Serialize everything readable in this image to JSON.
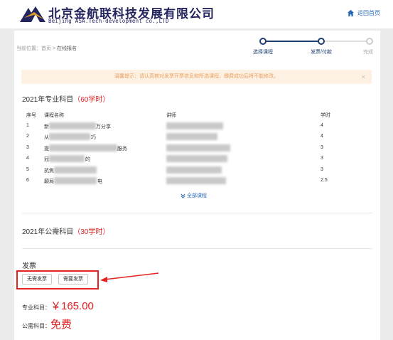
{
  "header": {
    "logo_cn": "北京金航联科技发展有限公司",
    "logo_en": "Beijing ASA.Tech-development co.,LTD",
    "home_link": "返回首页",
    "home_icon": "home-icon"
  },
  "breadcrumb": {
    "prefix": "当前位置：",
    "home": "首页",
    "sep": " > ",
    "current": "在线报名"
  },
  "steps": [
    {
      "label": "选择课程",
      "state": "done"
    },
    {
      "label": "发票/付款",
      "state": "done"
    },
    {
      "label": "完成",
      "state": "todo"
    }
  ],
  "notice": {
    "text": "温馨提示：请认真核对发票开票信息和所选课程，缴费成功后将不能修改。",
    "close": "×"
  },
  "professional": {
    "title": "2021年专业科目",
    "hours": "（60学时）",
    "headers": {
      "idx": "序号",
      "name": "课程名称",
      "teacher": "讲师",
      "hours": "学时"
    },
    "rows": [
      {
        "idx": "1",
        "name_start": "新",
        "name_end": "万分享",
        "hours": "4"
      },
      {
        "idx": "2",
        "name_start": "从",
        "name_end": "巧",
        "hours": "4"
      },
      {
        "idx": "3",
        "name_start": "提",
        "name_end": "服务",
        "hours": "3"
      },
      {
        "idx": "4",
        "name_start": "冠",
        "name_end": "的",
        "hours": "3"
      },
      {
        "idx": "5",
        "name_start": "抗焦",
        "name_end": "",
        "hours": "3"
      },
      {
        "idx": "6",
        "name_start": "颠局",
        "name_end": "电",
        "hours": "2.5"
      }
    ],
    "more_link": "全部课程",
    "more_icon": "chevron-double-down-icon"
  },
  "public": {
    "title": "2021年公需科目",
    "hours": "（30学时）"
  },
  "invoice": {
    "title": "发票",
    "no_invoice_button": "无需发票",
    "need_invoice_button": "需要发票"
  },
  "prices": {
    "professional_label": "专业科目：",
    "professional_value": "￥165.00",
    "public_label": "公需科目：",
    "public_value": "免费"
  },
  "colors": {
    "brand_navy": "#24245e",
    "accent_red": "#e02020",
    "link_blue": "#2a6bb8"
  }
}
